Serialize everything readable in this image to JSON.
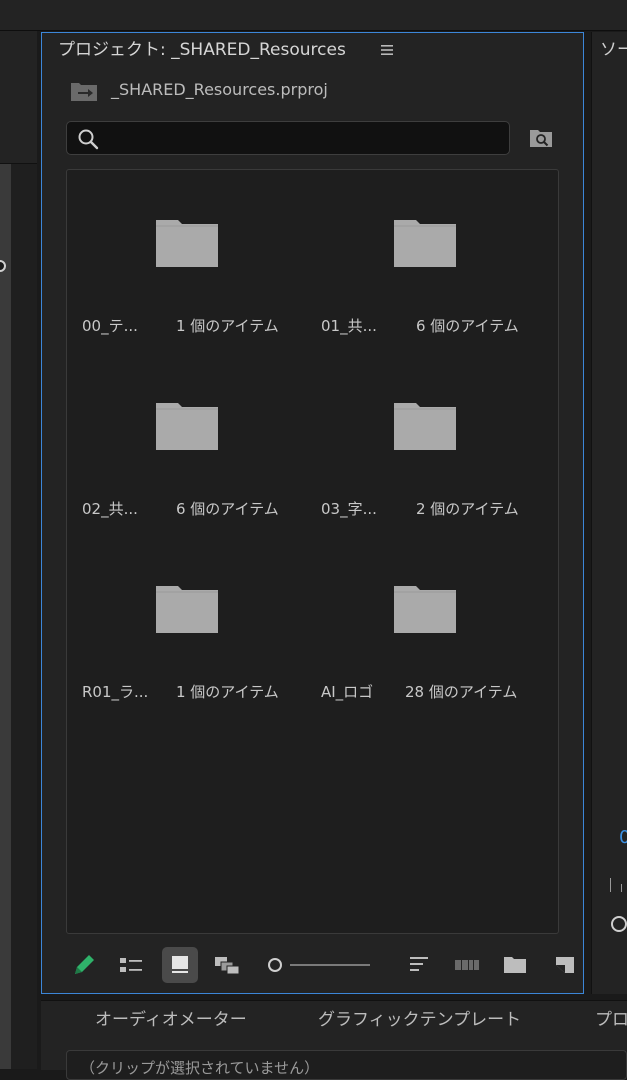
{
  "panel": {
    "title": "プロジェクト: _SHARED_Resources",
    "project_file": "_SHARED_Resources.prproj"
  },
  "search": {
    "value": "",
    "placeholder": ""
  },
  "items": [
    {
      "name": "00_テ...",
      "count": "1 個のアイテム",
      "icon": "folder-icon"
    },
    {
      "name": "01_共...",
      "count": "6 個のアイテム",
      "icon": "folder-icon"
    },
    {
      "name": "02_共...",
      "count": "6 個のアイテム",
      "icon": "folder-icon"
    },
    {
      "name": "03_字...",
      "count": "2 個のアイテム",
      "icon": "folder-icon"
    },
    {
      "name": "R01_ラ...",
      "count": "1 個のアイテム",
      "icon": "folder-icon"
    },
    {
      "name": "AI_ロゴ",
      "count": "28 個のアイテム",
      "icon": "folder-icon"
    }
  ],
  "toolbar": {
    "icons": [
      "pencil-icon",
      "list-view-icon",
      "icon-view-icon",
      "freeform-view-icon",
      "zoom-slider",
      "sort-icon",
      "automate-sequence-icon",
      "new-bin-icon",
      "new-item-icon"
    ],
    "active_view": "icon-view-icon"
  },
  "right_panel": {
    "title": "ソー",
    "blue_text": "0"
  },
  "bottom": {
    "tabs": [
      "オーディオメーター",
      "グラフィックテンプレート",
      "プロ"
    ],
    "message": "（クリップが選択されていません）"
  },
  "colors": {
    "accent_border": "#3c86d8",
    "folder": "#aaaaaa",
    "pencil": "#2fb26a",
    "timecode_blue": "#3b8fe0"
  }
}
